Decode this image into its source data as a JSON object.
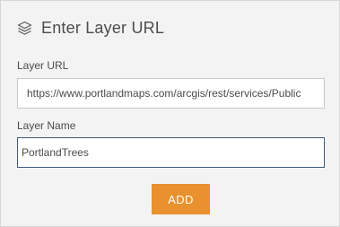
{
  "dialog": {
    "title": "Enter Layer URL",
    "icon": "layers-icon"
  },
  "layer_url": {
    "label": "Layer URL",
    "value": "https://www.portlandmaps.com/arcgis/rest/services/Public"
  },
  "layer_name": {
    "label": "Layer Name",
    "value": "PortlandTrees"
  },
  "actions": {
    "add_label": "ADD",
    "add_color": "#e8912e"
  }
}
